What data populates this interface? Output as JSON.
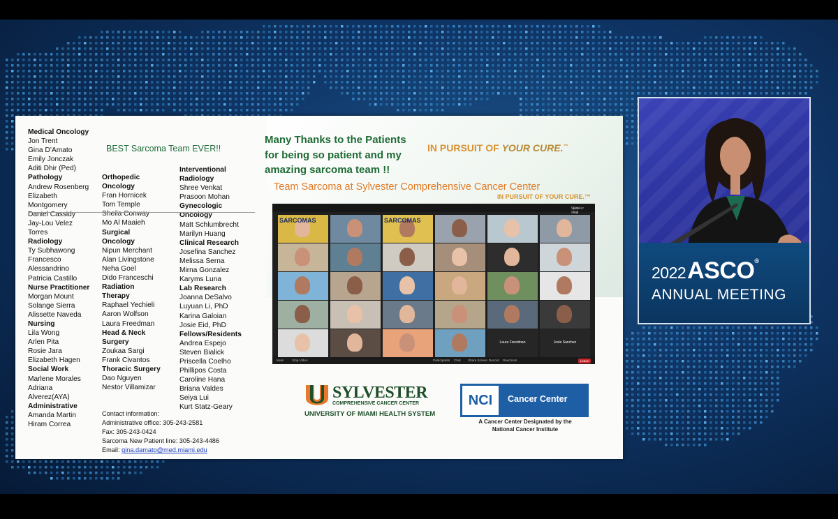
{
  "slide": {
    "best_team": "BEST Sarcoma Team EVER!!",
    "thanks_line1": "Many Thanks to the Patients",
    "thanks_line2": "for being so patient and my",
    "thanks_line3": "amazing sarcoma team !!",
    "pursuit_prefix": "IN PURSUIT OF ",
    "pursuit_em": "YOUR CURE.",
    "pursuit_tm": "™",
    "team_title": "Team Sarcoma at Sylvester Comprehensive Cancer Center",
    "pursuit_small": "IN PURSUIT OF YOUR CURE.™",
    "columns": [
      [
        {
          "t": "Medical Oncology",
          "h": true
        },
        {
          "t": "Jon Trent"
        },
        {
          "t": "Gina D’Amato"
        },
        {
          "t": "Emily Jonczak"
        },
        {
          "t": "Aditi Dhir (Ped)"
        },
        {
          "t": "Pathology",
          "h": true
        },
        {
          "t": "Andrew Rosenberg"
        },
        {
          "t": "Elizabeth"
        },
        {
          "t": "Montgomery"
        },
        {
          "t": "Daniel Cassidy"
        },
        {
          "t": "Jay-Lou Velez"
        },
        {
          "t": "Torres"
        },
        {
          "t": "Radiology",
          "h": true
        },
        {
          "t": "Ty Subhawong"
        },
        {
          "t": "Francesco"
        },
        {
          "t": "Alessandrino"
        },
        {
          "t": "Patricia Castillo"
        },
        {
          "t": "Nurse Practitioner",
          "h": true
        },
        {
          "t": "Morgan Mount"
        },
        {
          "t": "Solange Sierra"
        },
        {
          "t": "Alissette Naveda"
        },
        {
          "t": "Nursing",
          "h": true
        },
        {
          "t": "Lila Wong"
        },
        {
          "t": "Arlen Pita"
        },
        {
          "t": "Rosie Jara"
        },
        {
          "t": "Elizabeth Hagen"
        },
        {
          "t": "Social Work",
          "h": true
        },
        {
          "t": "Marlene Morales"
        },
        {
          "t": "Adriana"
        },
        {
          "t": "Alverez(AYA)"
        },
        {
          "t": "Administrative",
          "h": true
        },
        {
          "t": "Amanda Martin"
        },
        {
          "t": "Hiram Correa"
        }
      ],
      [
        {
          "t": "Orthopedic",
          "h": true
        },
        {
          "t": "Oncology",
          "h": true
        },
        {
          "t": "Fran Hornicek"
        },
        {
          "t": "Tom Temple"
        },
        {
          "t": "Sheila Conway"
        },
        {
          "t": "Mo Al Maaieh"
        },
        {
          "t": "Surgical",
          "h": true
        },
        {
          "t": "Oncology",
          "h": true
        },
        {
          "t": "Nipun Merchant"
        },
        {
          "t": "Alan Livingstone"
        },
        {
          "t": "Neha Goel"
        },
        {
          "t": "Dido Franceschi"
        },
        {
          "t": "Radiation",
          "h": true
        },
        {
          "t": "Therapy",
          "h": true
        },
        {
          "t": "Raphael Yechieli"
        },
        {
          "t": "Aaron Wolfson"
        },
        {
          "t": "Laura Freedman"
        },
        {
          "t": "Head & Neck",
          "h": true
        },
        {
          "t": "Surgery",
          "h": true
        },
        {
          "t": "Zoukaa Sargi"
        },
        {
          "t": "Frank Civantos"
        },
        {
          "t": "Thoracic Surgery",
          "h": true
        },
        {
          "t": "Dao Nguyen"
        },
        {
          "t": "Nestor Villamizar"
        }
      ],
      [
        {
          "t": "Interventional",
          "h": true
        },
        {
          "t": "Radiology",
          "h": true
        },
        {
          "t": "Shree Venkat"
        },
        {
          "t": "Prasoon Mohan"
        },
        {
          "t": "Gynecologic",
          "h": true
        },
        {
          "t": "Oncology",
          "h": true
        },
        {
          "t": "Matt Schlumbrecht"
        },
        {
          "t": "Marilyn Huang"
        },
        {
          "t": "Clinical Research",
          "h": true
        },
        {
          "t": "Josefina Sanchez"
        },
        {
          "t": "Melissa Serna"
        },
        {
          "t": "Mirna Gonzalez"
        },
        {
          "t": "Karyms Luna"
        },
        {
          "t": "Lab Research",
          "h": true
        },
        {
          "t": "Joanna DeSalvo"
        },
        {
          "t": "Luyuan Li, PhD"
        },
        {
          "t": "Karina Galoian"
        },
        {
          "t": "Josie Eid, PhD"
        },
        {
          "t": "Fellows/Residents",
          "h": true
        },
        {
          "t": "Andrea Espejo"
        },
        {
          "t": "Steven Bialick"
        },
        {
          "t": "Priscella Coelho"
        },
        {
          "t": "Phillipos Costa"
        },
        {
          "t": "Caroline Hana"
        },
        {
          "t": "Briana Valdes"
        },
        {
          "t": "Seiya Lui"
        },
        {
          "t": "Kurt Statz-Geary"
        }
      ]
    ],
    "contact": {
      "title": "Contact information:",
      "office": "Administrative office: 305-243-2581",
      "fax": "Fax: 305-243-0424",
      "new_patient": "Sarcoma New Patient line: 305-243-4486",
      "email_label": "Email: ",
      "email": "gina.damato@med.miami.edu"
    },
    "sylvester": {
      "name": "SYLVESTER",
      "sub": "COMPREHENSIVE CANCER CENTER",
      "umhs": "UNIVERSITY OF MIAMI HEALTH SYSTEM"
    },
    "nci": {
      "box": "NCI",
      "label": "Cancer Center",
      "sub1": "A Cancer Center Designated by the",
      "sub2": "National Cancer Institute"
    },
    "zoom": {
      "speaker_view": "Speaker View",
      "exit_full": "Exit Full Screen",
      "sarcomas": "SARCOMAS",
      "laura": "Laura Freedman",
      "josie": "Josie Sanchez",
      "leave": "Leave",
      "bar": [
        "Mute",
        "Stop Video",
        "Participants",
        "Chat",
        "Share Screen",
        "Record",
        "Reactions"
      ]
    }
  },
  "asco": {
    "year": "2022",
    "name": "ASCO",
    "reg": "®",
    "meeting": "ANNUAL MEETING"
  },
  "colors": {
    "green": "#1f6b35",
    "orange": "#e07a25",
    "gold": "#d8922f",
    "asco_blue": "#0f4a7e",
    "nci_blue": "#1d5ea5"
  }
}
